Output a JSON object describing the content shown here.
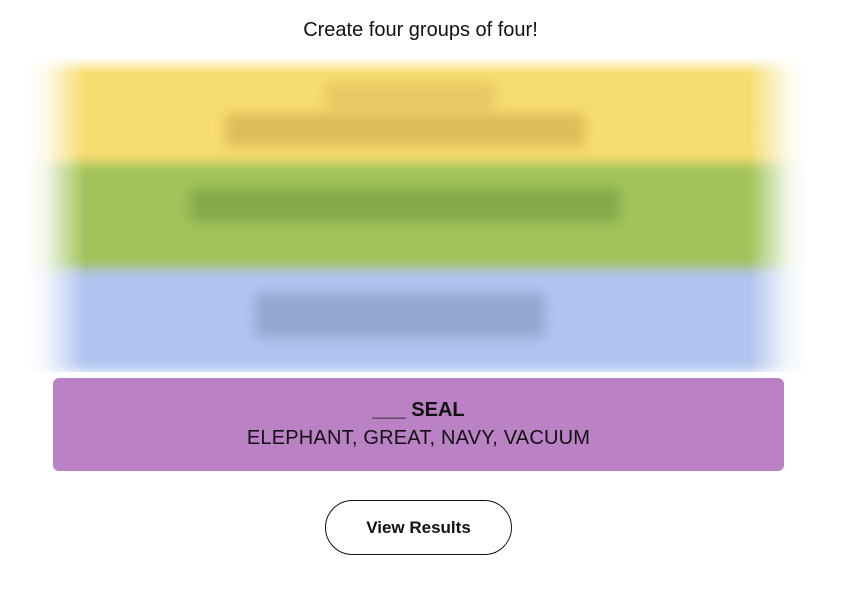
{
  "header": {
    "instructions": "Create four groups of four!"
  },
  "board": {
    "hidden_groups": [
      {
        "color": "#f7dc6f"
      },
      {
        "color": "#a0c35a"
      },
      {
        "color": "#b0c4ef"
      }
    ]
  },
  "solved_group": {
    "color": "#ba81c5",
    "title": "___ SEAL",
    "members": "ELEPHANT, GREAT, NAVY, VACUUM"
  },
  "actions": {
    "view_results_label": "View Results"
  }
}
